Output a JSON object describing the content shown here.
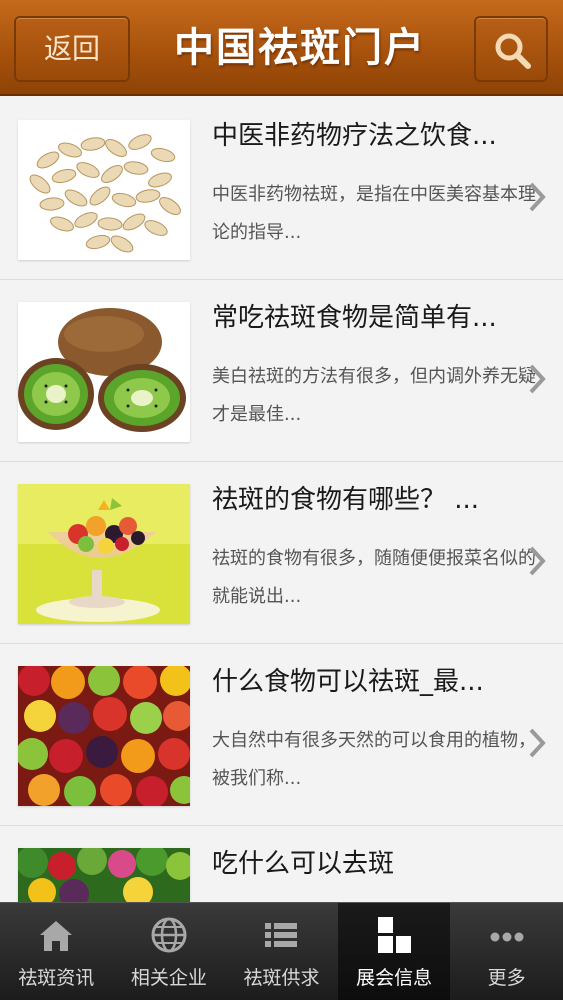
{
  "header": {
    "back_label": "返回",
    "title": "中国祛斑门户",
    "search_icon": "search-icon"
  },
  "articles": [
    {
      "title": "中医非药物疗法之饮食...",
      "description": "中医非药物祛斑，是指在中医美容基本理论的指导...",
      "thumb": "sliced-almonds"
    },
    {
      "title": "常吃祛斑食物是简单有...",
      "description": "美白祛斑的方法有很多，但内调外养无疑才是最佳...",
      "thumb": "kiwi-fruit"
    },
    {
      "title": "祛斑的食物有哪些？ ...",
      "description": "祛斑的食物有很多，随随便便报菜名似的就能说出...",
      "thumb": "fruit-salad-cup"
    },
    {
      "title": "什么食物可以祛斑_最...",
      "description": "大自然中有很多天然的可以食用的植物，被我们称...",
      "thumb": "assorted-fruits"
    },
    {
      "title": "吃什么可以去斑",
      "description": "",
      "thumb": "fruits-vegetables"
    }
  ],
  "tabs": [
    {
      "label": "祛斑资讯",
      "icon": "home-icon",
      "active": false
    },
    {
      "label": "相关企业",
      "icon": "globe-icon",
      "active": false
    },
    {
      "label": "祛斑供求",
      "icon": "list-icon",
      "active": false
    },
    {
      "label": "展会信息",
      "icon": "blocks-icon",
      "active": true
    },
    {
      "label": "更多",
      "icon": "more-dots-icon",
      "active": false
    }
  ],
  "colors": {
    "header": "#a8520c",
    "tabbar": "#2a2a2a",
    "active_tab": "#0d0d0d"
  }
}
